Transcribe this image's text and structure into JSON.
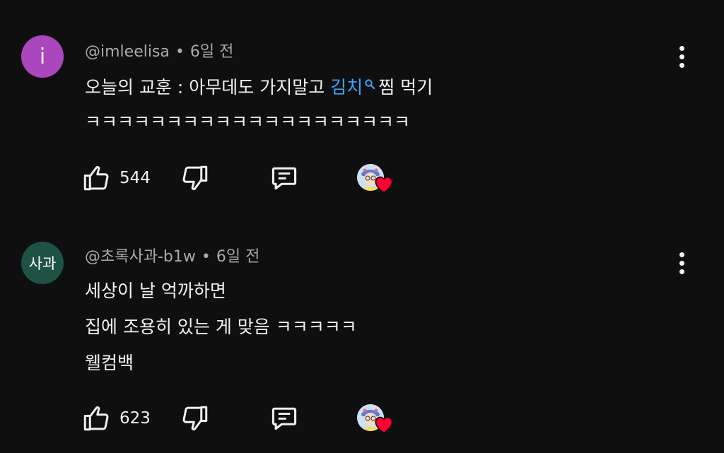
{
  "comments": [
    {
      "avatar": {
        "letter": "i",
        "color": "#ab47bc"
      },
      "author": "@imleelisa",
      "time": "6일 전",
      "lines": [
        {
          "before": "오늘의 교훈 : 아무데도 가지말고 ",
          "link": "김치",
          "after": "찜 먹기"
        },
        {
          "text": "ㅋㅋㅋㅋㅋㅋㅋㅋㅋㅋㅋㅋㅋㅋㅋㅋㅋㅋㅋㅋ"
        }
      ],
      "likes": "544"
    },
    {
      "avatar": {
        "letter": "사과",
        "color": "#1e5245"
      },
      "author": "@초록사과-b1w",
      "time": "6일 전",
      "lines": [
        {
          "text": "세상이 날 억까하면"
        },
        {
          "text": "집에 조용히 있는 게 맞음 ㅋㅋㅋㅋㅋ"
        },
        {
          "text": "웰컴백"
        }
      ],
      "likes": "623"
    }
  ],
  "icons": {
    "like": "thumb-up-icon",
    "dislike": "thumb-down-icon",
    "reply": "reply-comment-icon",
    "more": "more-vertical-icon",
    "search": "search-icon",
    "creator_heart": "creator-heart-icon"
  },
  "colors": {
    "link": "#3ea6ff",
    "heart": "#ff0033",
    "muted": "#aaaaaa"
  }
}
